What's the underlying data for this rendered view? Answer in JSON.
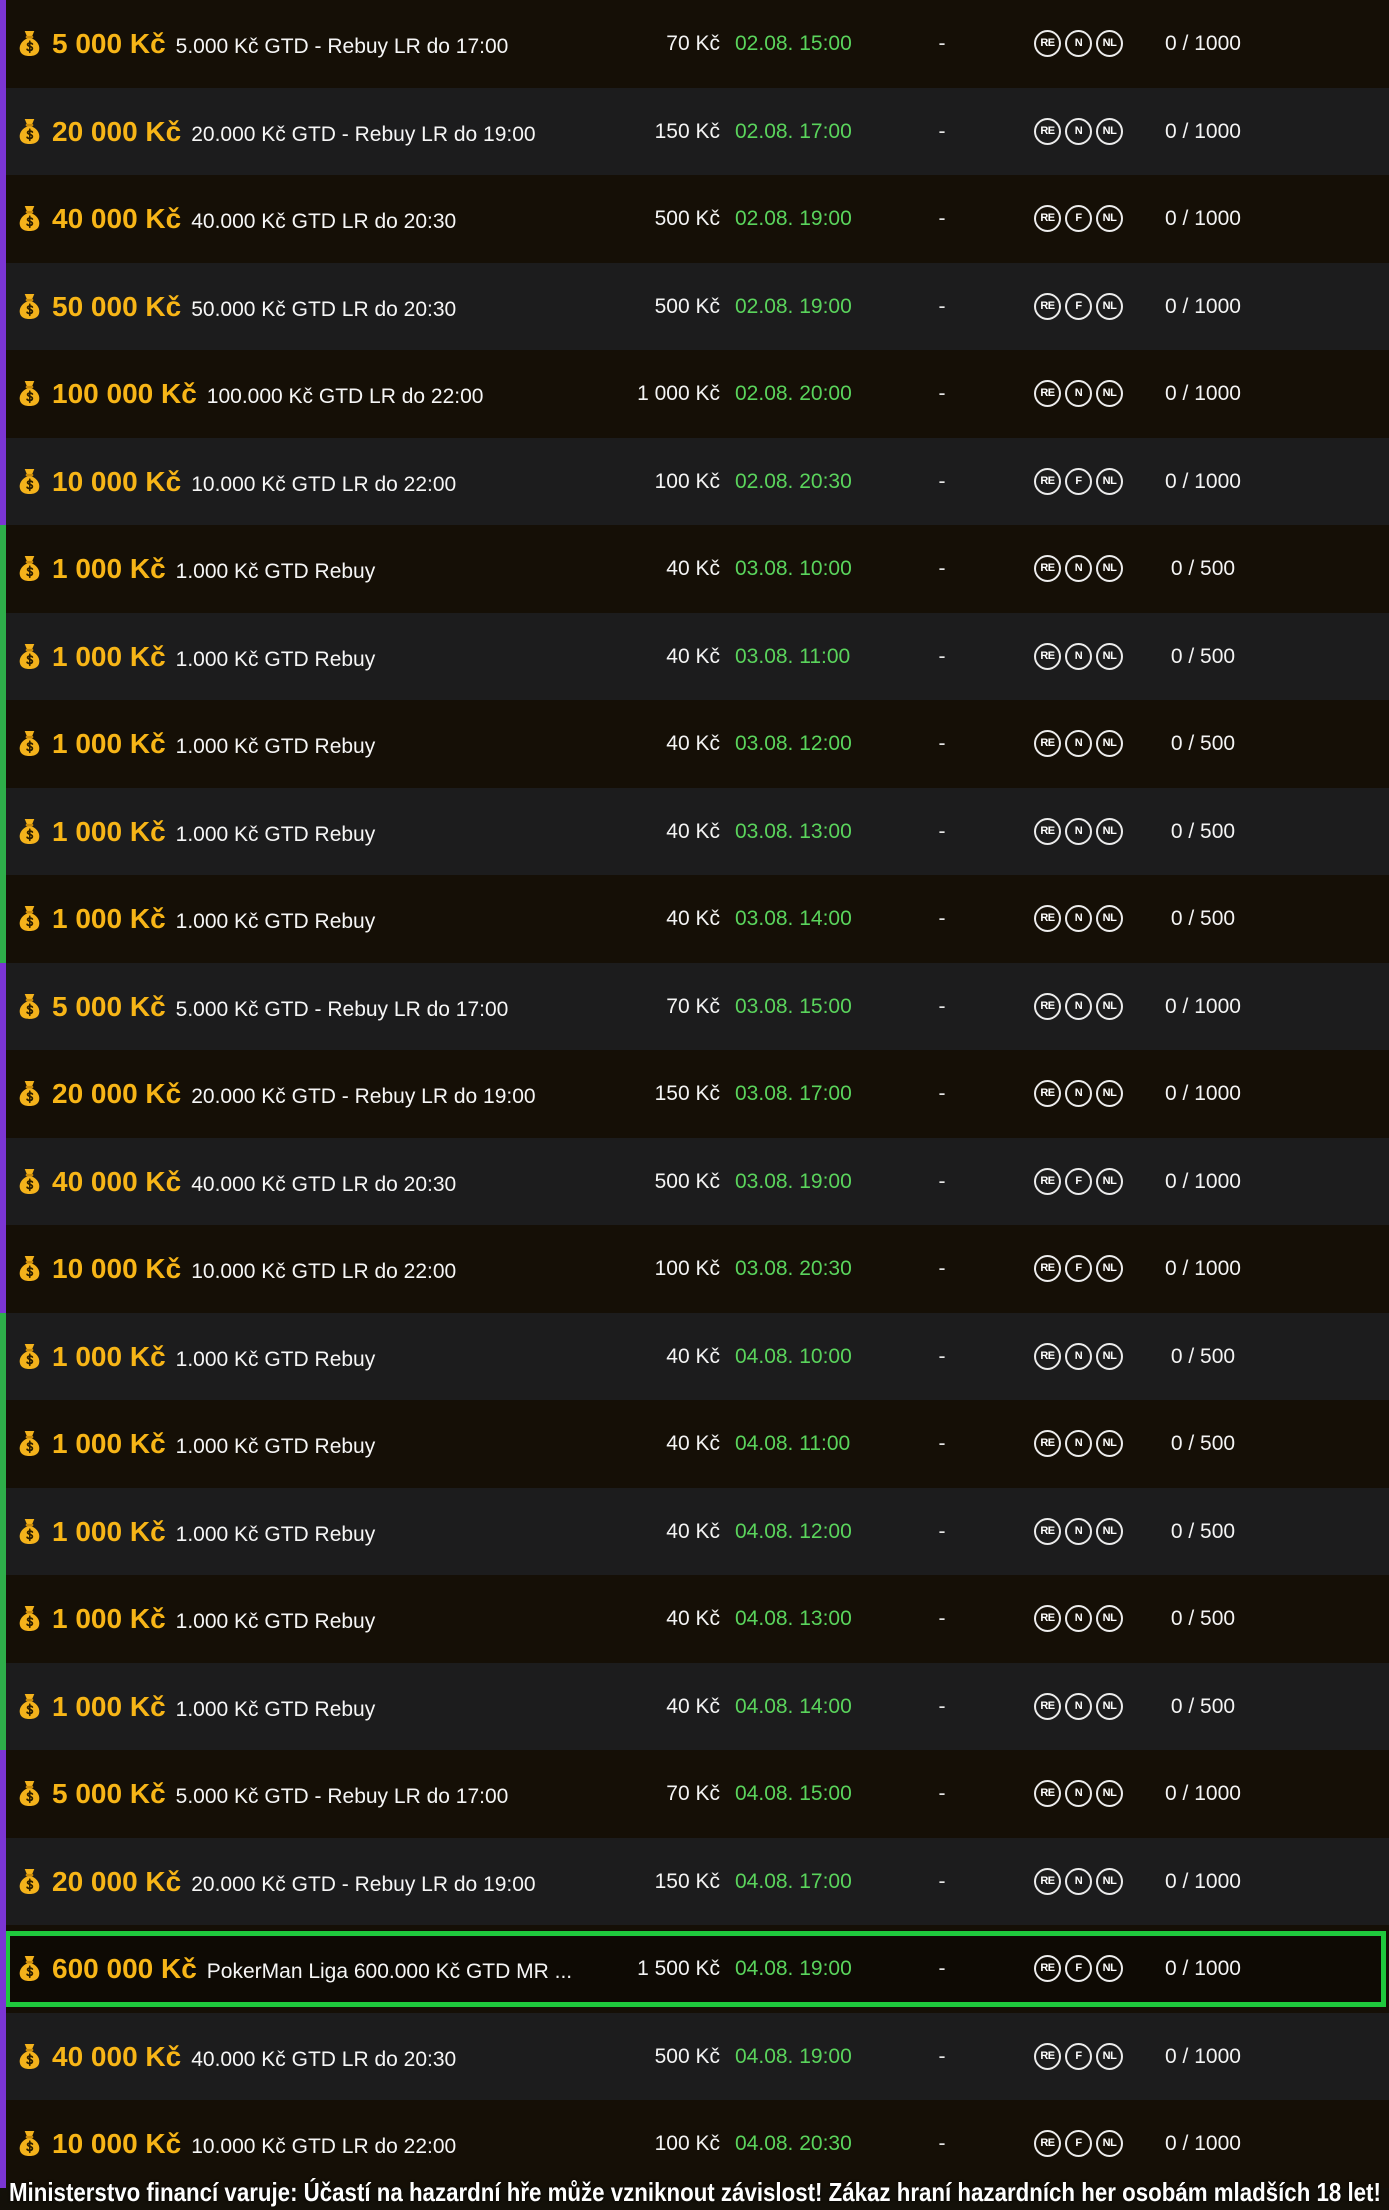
{
  "colors": {
    "guarantee": "#f7b517",
    "date": "#5ad45c",
    "selected_border": "#1fc93d"
  },
  "rows": [
    {
      "guarantee": "5 000 Kč",
      "name": "5.000 Kč GTD - Rebuy LR do 17:00",
      "buyin": "70 Kč",
      "date": "02.08. 15:00",
      "late": "-",
      "badges": [
        "RE",
        "N",
        "NL"
      ],
      "seats": "0 / 1000",
      "bar_color": "#7b35d4"
    },
    {
      "guarantee": "20 000 Kč",
      "name": "20.000 Kč GTD - Rebuy LR do 19:00",
      "buyin": "150 Kč",
      "date": "02.08. 17:00",
      "late": "-",
      "badges": [
        "RE",
        "N",
        "NL"
      ],
      "seats": "0 / 1000",
      "bar_color": "#7b35d4"
    },
    {
      "guarantee": "40 000 Kč",
      "name": "40.000 Kč GTD LR do 20:30",
      "buyin": "500 Kč",
      "date": "02.08. 19:00",
      "late": "-",
      "badges": [
        "RE",
        "F",
        "NL"
      ],
      "seats": "0 / 1000",
      "bar_color": "#7b35d4"
    },
    {
      "guarantee": "50 000 Kč",
      "name": "50.000 Kč GTD LR do 20:30",
      "buyin": "500 Kč",
      "date": "02.08. 19:00",
      "late": "-",
      "badges": [
        "RE",
        "F",
        "NL"
      ],
      "seats": "0 / 1000",
      "bar_color": "#7b35d4"
    },
    {
      "guarantee": "100 000 Kč",
      "name": "100.000 Kč GTD LR do 22:00",
      "buyin": "1 000 Kč",
      "date": "02.08. 20:00",
      "late": "-",
      "badges": [
        "RE",
        "N",
        "NL"
      ],
      "seats": "0 / 1000",
      "bar_color": "#7b35d4"
    },
    {
      "guarantee": "10 000 Kč",
      "name": "10.000 Kč GTD LR do 22:00",
      "buyin": "100 Kč",
      "date": "02.08. 20:30",
      "late": "-",
      "badges": [
        "RE",
        "F",
        "NL"
      ],
      "seats": "0 / 1000",
      "bar_color": "#7b35d4"
    },
    {
      "guarantee": "1 000 Kč",
      "name": "1.000 Kč GTD Rebuy",
      "buyin": "40 Kč",
      "date": "03.08. 10:00",
      "late": "-",
      "badges": [
        "RE",
        "N",
        "NL"
      ],
      "seats": "0 / 500",
      "bar_color": "#2eae4a"
    },
    {
      "guarantee": "1 000 Kč",
      "name": "1.000 Kč GTD Rebuy",
      "buyin": "40 Kč",
      "date": "03.08. 11:00",
      "late": "-",
      "badges": [
        "RE",
        "N",
        "NL"
      ],
      "seats": "0 / 500",
      "bar_color": "#2eae4a"
    },
    {
      "guarantee": "1 000 Kč",
      "name": "1.000 Kč GTD Rebuy",
      "buyin": "40 Kč",
      "date": "03.08. 12:00",
      "late": "-",
      "badges": [
        "RE",
        "N",
        "NL"
      ],
      "seats": "0 / 500",
      "bar_color": "#2eae4a"
    },
    {
      "guarantee": "1 000 Kč",
      "name": "1.000 Kč GTD Rebuy",
      "buyin": "40 Kč",
      "date": "03.08. 13:00",
      "late": "-",
      "badges": [
        "RE",
        "N",
        "NL"
      ],
      "seats": "0 / 500",
      "bar_color": "#2eae4a"
    },
    {
      "guarantee": "1 000 Kč",
      "name": "1.000 Kč GTD Rebuy",
      "buyin": "40 Kč",
      "date": "03.08. 14:00",
      "late": "-",
      "badges": [
        "RE",
        "N",
        "NL"
      ],
      "seats": "0 / 500",
      "bar_color": "#2eae4a"
    },
    {
      "guarantee": "5 000 Kč",
      "name": "5.000 Kč GTD - Rebuy LR do 17:00",
      "buyin": "70 Kč",
      "date": "03.08. 15:00",
      "late": "-",
      "badges": [
        "RE",
        "N",
        "NL"
      ],
      "seats": "0 / 1000",
      "bar_color": "#7b35d4"
    },
    {
      "guarantee": "20 000 Kč",
      "name": "20.000 Kč GTD - Rebuy LR do 19:00",
      "buyin": "150 Kč",
      "date": "03.08. 17:00",
      "late": "-",
      "badges": [
        "RE",
        "N",
        "NL"
      ],
      "seats": "0 / 1000",
      "bar_color": "#7b35d4"
    },
    {
      "guarantee": "40 000 Kč",
      "name": "40.000 Kč GTD LR do 20:30",
      "buyin": "500 Kč",
      "date": "03.08. 19:00",
      "late": "-",
      "badges": [
        "RE",
        "F",
        "NL"
      ],
      "seats": "0 / 1000",
      "bar_color": "#7b35d4"
    },
    {
      "guarantee": "10 000 Kč",
      "name": "10.000 Kč GTD LR do 22:00",
      "buyin": "100 Kč",
      "date": "03.08. 20:30",
      "late": "-",
      "badges": [
        "RE",
        "F",
        "NL"
      ],
      "seats": "0 / 1000",
      "bar_color": "#7b35d4"
    },
    {
      "guarantee": "1 000 Kč",
      "name": "1.000 Kč GTD Rebuy",
      "buyin": "40 Kč",
      "date": "04.08. 10:00",
      "late": "-",
      "badges": [
        "RE",
        "N",
        "NL"
      ],
      "seats": "0 / 500",
      "bar_color": "#2eae4a"
    },
    {
      "guarantee": "1 000 Kč",
      "name": "1.000 Kč GTD Rebuy",
      "buyin": "40 Kč",
      "date": "04.08. 11:00",
      "late": "-",
      "badges": [
        "RE",
        "N",
        "NL"
      ],
      "seats": "0 / 500",
      "bar_color": "#2eae4a"
    },
    {
      "guarantee": "1 000 Kč",
      "name": "1.000 Kč GTD Rebuy",
      "buyin": "40 Kč",
      "date": "04.08. 12:00",
      "late": "-",
      "badges": [
        "RE",
        "N",
        "NL"
      ],
      "seats": "0 / 500",
      "bar_color": "#2eae4a"
    },
    {
      "guarantee": "1 000 Kč",
      "name": "1.000 Kč GTD Rebuy",
      "buyin": "40 Kč",
      "date": "04.08. 13:00",
      "late": "-",
      "badges": [
        "RE",
        "N",
        "NL"
      ],
      "seats": "0 / 500",
      "bar_color": "#2eae4a"
    },
    {
      "guarantee": "1 000 Kč",
      "name": "1.000 Kč GTD Rebuy",
      "buyin": "40 Kč",
      "date": "04.08. 14:00",
      "late": "-",
      "badges": [
        "RE",
        "N",
        "NL"
      ],
      "seats": "0 / 500",
      "bar_color": "#2eae4a"
    },
    {
      "guarantee": "5 000 Kč",
      "name": "5.000 Kč GTD - Rebuy LR do 17:00",
      "buyin": "70 Kč",
      "date": "04.08. 15:00",
      "late": "-",
      "badges": [
        "RE",
        "N",
        "NL"
      ],
      "seats": "0 / 1000",
      "bar_color": "#7b35d4"
    },
    {
      "guarantee": "20 000 Kč",
      "name": "20.000 Kč GTD - Rebuy LR do 19:00",
      "buyin": "150 Kč",
      "date": "04.08. 17:00",
      "late": "-",
      "badges": [
        "RE",
        "N",
        "NL"
      ],
      "seats": "0 / 1000",
      "bar_color": "#7b35d4"
    },
    {
      "guarantee": "600 000 Kč",
      "name": "PokerMan Liga 600.000 Kč GTD MR ...",
      "buyin": "1 500 Kč",
      "date": "04.08. 19:00",
      "late": "-",
      "badges": [
        "RE",
        "F",
        "NL"
      ],
      "seats": "0 / 1000",
      "bar_color": "#7b35d4",
      "selected": true
    },
    {
      "guarantee": "40 000 Kč",
      "name": "40.000 Kč GTD LR do 20:30",
      "buyin": "500 Kč",
      "date": "04.08. 19:00",
      "late": "-",
      "badges": [
        "RE",
        "F",
        "NL"
      ],
      "seats": "0 / 1000",
      "bar_color": "#7b35d4"
    },
    {
      "guarantee": "10 000 Kč",
      "name": "10.000 Kč GTD LR do 22:00",
      "buyin": "100 Kč",
      "date": "04.08. 20:30",
      "late": "-",
      "badges": [
        "RE",
        "F",
        "NL"
      ],
      "seats": "0 / 1000",
      "bar_color": "#7b35d4"
    }
  ],
  "footer": {
    "warning": "Ministerstvo financí varuje: Účastí na hazardní hře může vzniknout závislost! Zákaz hraní hazardních her osobám mladších 18 let!"
  }
}
